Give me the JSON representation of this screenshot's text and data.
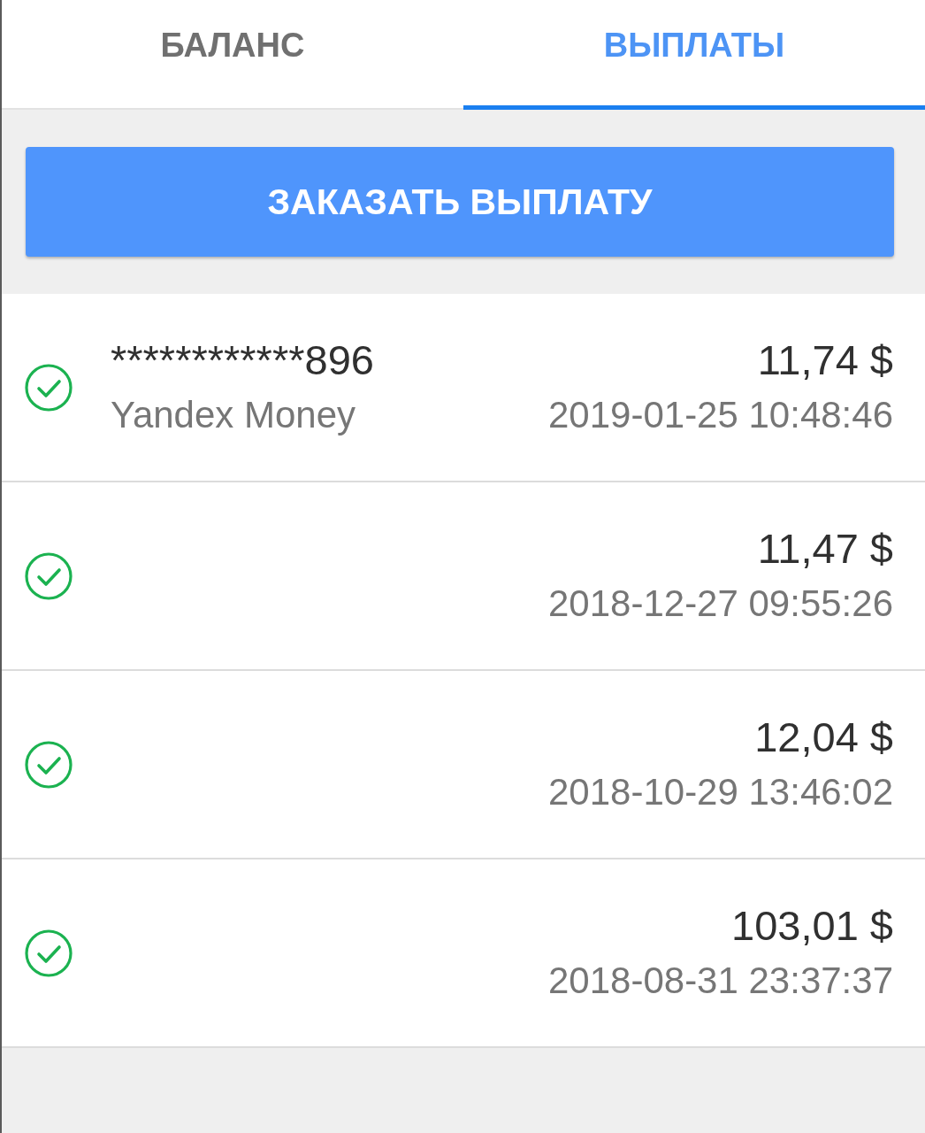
{
  "tabs": [
    {
      "label": "БАЛАНС",
      "selected": false
    },
    {
      "label": "ВЫПЛАТЫ",
      "selected": true
    }
  ],
  "order_button": {
    "label": "ЗАКАЗАТЬ ВЫПЛАТУ"
  },
  "payouts": [
    {
      "completed": true,
      "account": "************896",
      "method": "Yandex Money",
      "amount": "11,74 $",
      "datetime": "2019-01-25 10:48:46"
    },
    {
      "completed": true,
      "amount": "11,47 $",
      "datetime": "2018-12-27 09:55:26"
    },
    {
      "completed": true,
      "amount": "12,04 $",
      "datetime": "2018-10-29 13:46:02"
    },
    {
      "completed": true,
      "amount": "103,01 $",
      "datetime": "2018-08-31 23:37:37"
    }
  ]
}
